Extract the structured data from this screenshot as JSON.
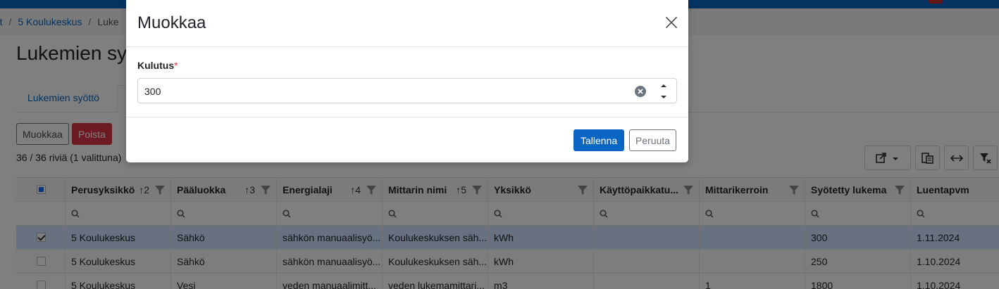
{
  "breadcrumb": {
    "items": [
      "eet",
      "5 Koulukeskus",
      "Luke"
    ]
  },
  "page": {
    "title": "Lukemien sy"
  },
  "tabs": [
    {
      "label": "Lukemien syöttö"
    }
  ],
  "actions": {
    "edit_label": "Muokkaa",
    "delete_label": "Poista"
  },
  "row_count": "36 / 36 riviä (1 valittuna)",
  "grid": {
    "columns": [
      {
        "label": "Perusyksikkö",
        "sort": "2"
      },
      {
        "label": "Pääluokka",
        "sort": "3"
      },
      {
        "label": "Energialaji",
        "sort": "4"
      },
      {
        "label": "Mittarin nimi",
        "sort": "5"
      },
      {
        "label": "Yksikkö",
        "sort": ""
      },
      {
        "label": "Käyttöpaikkatu...",
        "sort": ""
      },
      {
        "label": "Mittarikerroin",
        "sort": ""
      },
      {
        "label": "Syötetty lukema",
        "sort": ""
      },
      {
        "label": "Luentapvm",
        "sort": ""
      }
    ],
    "rows": [
      {
        "selected": true,
        "cells": [
          "5 Koulukeskus",
          "Sähkö",
          "sähkön manuaalisyö...",
          "Koulukeskuksen säh...",
          "kWh",
          "",
          "",
          "300",
          "1.11.2024"
        ]
      },
      {
        "selected": false,
        "cells": [
          "5 Koulukeskus",
          "Sähkö",
          "sähkön manuaalisyö...",
          "Koulukeskuksen säh...",
          "kWh",
          "",
          "",
          "250",
          "1.10.2024"
        ]
      },
      {
        "selected": false,
        "cells": [
          "5 Koulukeskus",
          "Vesi",
          "veden manuaalimitt...",
          "veden lukemamittari...",
          "m3",
          "",
          "1",
          "1800",
          "1.10.2024"
        ]
      }
    ]
  },
  "modal": {
    "title": "Muokkaa",
    "field_label": "Kulutus",
    "required_mark": "*",
    "field_value": "300",
    "save_label": "Tallenna",
    "cancel_label": "Peruuta"
  },
  "colors": {
    "primary": "#0a66c2",
    "danger": "#dc3545",
    "selected_row": "#cfe2ff"
  }
}
